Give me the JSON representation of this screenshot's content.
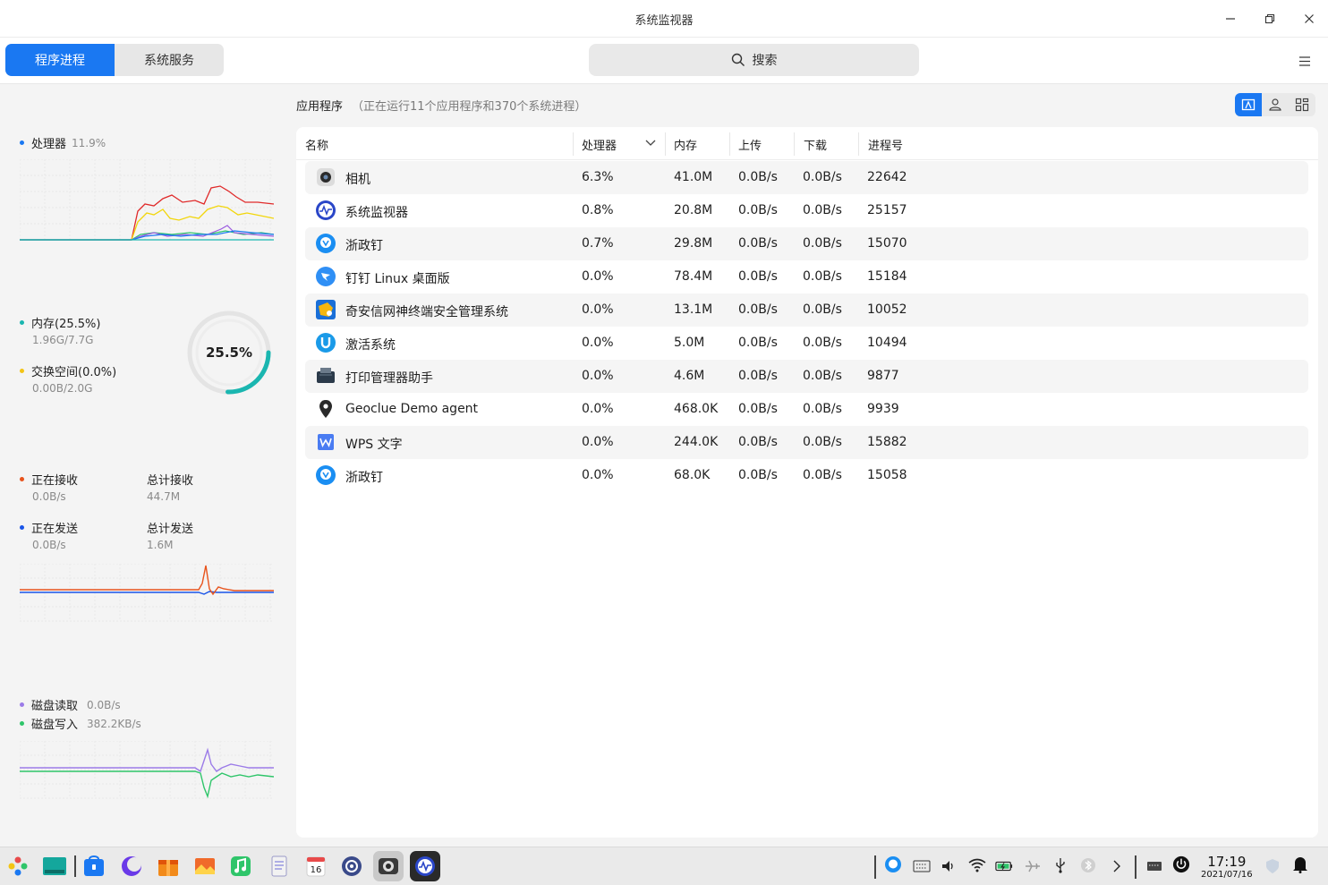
{
  "window": {
    "title": "系统监视器"
  },
  "tabs": [
    {
      "label": "程序进程",
      "active": true
    },
    {
      "label": "系统服务",
      "active": false
    }
  ],
  "search": {
    "placeholder": "搜索"
  },
  "cpu": {
    "label": "处理器",
    "value": "11.9%"
  },
  "memory": {
    "label": "内存(25.5%)",
    "detail": "1.96G/7.7G",
    "gauge_text": "25.5%",
    "percent": 25.5
  },
  "swap": {
    "label": "交换空间(0.0%)",
    "detail": "0.00B/2.0G"
  },
  "network": {
    "receiving_label": "正在接收",
    "receiving_value": "0.0B/s",
    "total_recv_label": "总计接收",
    "total_recv_value": "44.7M",
    "sending_label": "正在发送",
    "sending_value": "0.0B/s",
    "total_send_label": "总计发送",
    "total_send_value": "1.6M"
  },
  "disk": {
    "read_label": "磁盘读取",
    "read_value": "0.0B/s",
    "write_label": "磁盘写入",
    "write_value": "382.2KB/s"
  },
  "main": {
    "label": "应用程序",
    "info": "（正在运行11个应用程序和370个系统进程）"
  },
  "columns": [
    "名称",
    "处理器",
    "内存",
    "上传",
    "下载",
    "进程号"
  ],
  "processes": [
    {
      "name": "相机",
      "cpu": "6.3%",
      "mem": "41.0M",
      "up": "0.0B/s",
      "down": "0.0B/s",
      "pid": "22642",
      "icon": "camera-icon"
    },
    {
      "name": "系统监视器",
      "cpu": "0.8%",
      "mem": "20.8M",
      "up": "0.0B/s",
      "down": "0.0B/s",
      "pid": "25157",
      "icon": "system-monitor-icon"
    },
    {
      "name": "浙政钉",
      "cpu": "0.7%",
      "mem": "29.8M",
      "up": "0.0B/s",
      "down": "0.0B/s",
      "pid": "15070",
      "icon": "zhezhengding-icon"
    },
    {
      "name": "钉钉 Linux 桌面版",
      "cpu": "0.0%",
      "mem": "78.4M",
      "up": "0.0B/s",
      "down": "0.0B/s",
      "pid": "15184",
      "icon": "dingtalk-icon"
    },
    {
      "name": "奇安信网神终端安全管理系统",
      "cpu": "0.0%",
      "mem": "13.1M",
      "up": "0.0B/s",
      "down": "0.0B/s",
      "pid": "10052",
      "icon": "qianxin-icon"
    },
    {
      "name": "激活系统",
      "cpu": "0.0%",
      "mem": "5.0M",
      "up": "0.0B/s",
      "down": "0.0B/s",
      "pid": "10494",
      "icon": "activation-icon"
    },
    {
      "name": "打印管理器助手",
      "cpu": "0.0%",
      "mem": "4.6M",
      "up": "0.0B/s",
      "down": "0.0B/s",
      "pid": "9877",
      "icon": "printer-icon"
    },
    {
      "name": "Geoclue Demo agent",
      "cpu": "0.0%",
      "mem": "468.0K",
      "up": "0.0B/s",
      "down": "0.0B/s",
      "pid": "9939",
      "icon": "location-pin-icon"
    },
    {
      "name": "WPS 文字",
      "cpu": "0.0%",
      "mem": "244.0K",
      "up": "0.0B/s",
      "down": "0.0B/s",
      "pid": "15882",
      "icon": "wps-writer-icon"
    },
    {
      "name": "浙政钉",
      "cpu": "0.0%",
      "mem": "68.0K",
      "up": "0.0B/s",
      "down": "0.0B/s",
      "pid": "15058",
      "icon": "zhezhengding-icon"
    }
  ],
  "taskbar": {
    "time": "17:19",
    "date": "2021/07/16",
    "calendar_day": "16"
  },
  "colors": {
    "accent": "#1a78f2",
    "cpu_dot": "#1a78f2",
    "mem_dot": "#1ab6b0",
    "swap_dot": "#f3c415",
    "recv_dot": "#e8531c",
    "send_dot": "#1a55e8",
    "read_dot": "#9b7be8",
    "write_dot": "#2fc56a"
  }
}
